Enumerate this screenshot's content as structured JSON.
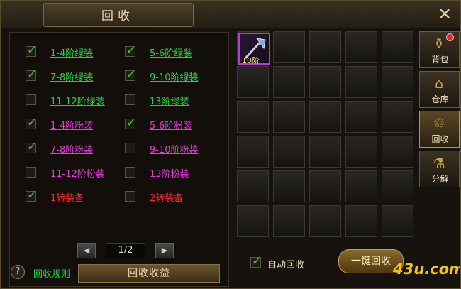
{
  "title": "回收",
  "options": [
    {
      "label": "1-4阶绿装",
      "checked": true,
      "color": "#2ecc40"
    },
    {
      "label": "5-6阶绿装",
      "checked": true,
      "color": "#2ecc40"
    },
    {
      "label": "7-8阶绿装",
      "checked": true,
      "color": "#2ecc40"
    },
    {
      "label": "9-10阶绿装",
      "checked": true,
      "color": "#2ecc40"
    },
    {
      "label": "11-12阶绿装",
      "checked": false,
      "color": "#2ecc40"
    },
    {
      "label": "13阶绿装",
      "checked": false,
      "color": "#2ecc40"
    },
    {
      "label": "1-4阶粉装",
      "checked": true,
      "color": "#e23bd6"
    },
    {
      "label": "5-6阶粉装",
      "checked": true,
      "color": "#e23bd6"
    },
    {
      "label": "7-8阶粉装",
      "checked": true,
      "color": "#e23bd6"
    },
    {
      "label": "9-10阶粉装",
      "checked": false,
      "color": "#e23bd6"
    },
    {
      "label": "11-12阶粉装",
      "checked": false,
      "color": "#e23bd6"
    },
    {
      "label": "13阶粉装",
      "checked": false,
      "color": "#e23bd6"
    },
    {
      "label": "1转装备",
      "checked": true,
      "color": "#ff2a2a"
    },
    {
      "label": "2转装备",
      "checked": false,
      "color": "#ff2a2a"
    }
  ],
  "pager": {
    "text": "1/2"
  },
  "earnings_button": "回收收益",
  "rules_link": "回收规则",
  "help_icon": "?",
  "auto_recycle": {
    "label": "自动回收",
    "checked": true
  },
  "one_key_button": "一键回收",
  "item": {
    "level": "10阶",
    "border_color": "#b83ad6"
  },
  "side_tabs": [
    {
      "label": "背包",
      "icon": "bag-icon",
      "glyph": "⚱",
      "badge": true
    },
    {
      "label": "仓库",
      "icon": "warehouse-icon",
      "glyph": "⌂",
      "badge": false
    },
    {
      "label": "回收",
      "icon": "recycle-icon",
      "glyph": "♲",
      "badge": false,
      "active": true
    },
    {
      "label": "分解",
      "icon": "decompose-icon",
      "glyph": "⚗",
      "badge": false
    }
  ],
  "watermark": "43u.com"
}
